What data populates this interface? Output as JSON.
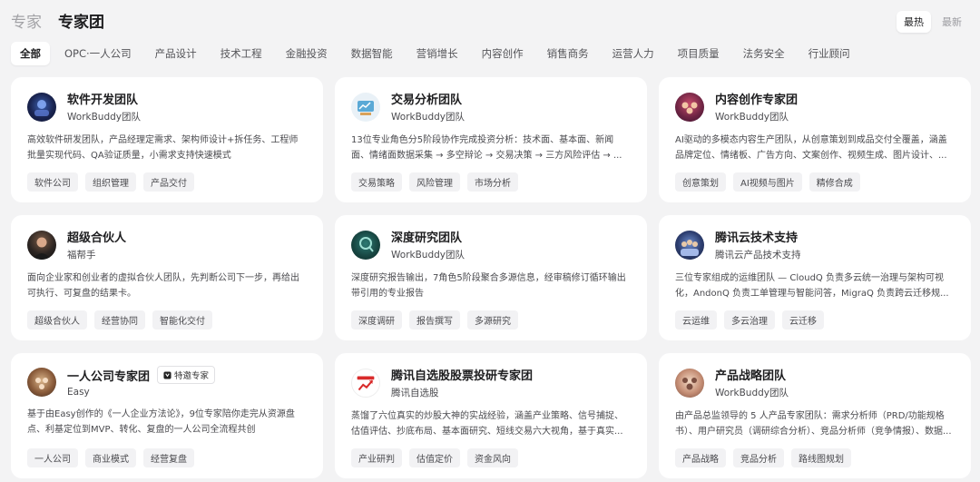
{
  "header": {
    "crumb": "专家",
    "title": "专家团"
  },
  "sort": {
    "hot": "最热",
    "new": "最新"
  },
  "tabs": [
    "全部",
    "OPC·一人公司",
    "产品设计",
    "技术工程",
    "金融投资",
    "数据智能",
    "营销增长",
    "内容创作",
    "销售商务",
    "运营人力",
    "项目质量",
    "法务安全",
    "行业顾问"
  ],
  "cards": [
    {
      "name": "软件开发团队",
      "org": "WorkBuddy团队",
      "desc": "高效软件研发团队，产品经理定需求、架构师设计+拆任务、工程师批量实现代码、QA验证质量，小需求支持快速模式",
      "tags": [
        "软件公司",
        "组织管理",
        "产品交付"
      ]
    },
    {
      "name": "交易分析团队",
      "org": "WorkBuddy团队",
      "desc": "13位专业角色分5阶段协作完成投资分析：技术面、基本面、新闻面、情绪面数据采集 → 多空辩论 → 交易决策 → 三方风险评估 → ...",
      "tags": [
        "交易策略",
        "风险管理",
        "市场分析"
      ]
    },
    {
      "name": "内容创作专家团",
      "org": "WorkBuddy团队",
      "desc": "AI驱动的多模态内容生产团队，从创意策划到成品交付全覆盖，涵盖品牌定位、情绪板、广告方向、文案创作、视频生成、图片设计、...",
      "tags": [
        "创意策划",
        "AI视频与图片",
        "精修合成"
      ]
    },
    {
      "name": "超级合伙人",
      "org": "福帮手",
      "desc": "面向企业家和创业者的虚拟合伙人团队，先判断公司下一步，再给出可执行、可复盘的结果卡。",
      "tags": [
        "超级合伙人",
        "经营协同",
        "智能化交付"
      ]
    },
    {
      "name": "深度研究团队",
      "org": "WorkBuddy团队",
      "desc": "深度研究报告输出，7角色5阶段聚合多源信息，经审稿修订循环输出带引用的专业报告",
      "tags": [
        "深度调研",
        "报告撰写",
        "多源研究"
      ]
    },
    {
      "name": "腾讯云技术支持",
      "org": "腾讯云产品技术支持",
      "desc": "三位专家组成的运维团队 — CloudQ 负责多云统一治理与架构可视化，AndonQ 负责工单管理与智能问答，MigraQ 负责跨云迁移规...",
      "tags": [
        "云运维",
        "多云治理",
        "云迁移"
      ]
    },
    {
      "name": "一人公司专家团",
      "badge": "特邀专家",
      "org": "Easy",
      "desc": "基于由Easy创作的《一人企业方法论》，9位专家陪你走完从资源盘点、利基定位到MVP、转化、复盘的一人公司全流程共创",
      "tags": [
        "一人公司",
        "商业模式",
        "经营复盘"
      ]
    },
    {
      "name": "腾讯自选股股票投研专家团",
      "org": "腾讯自选股",
      "desc": "蒸馏了六位真实的炒股大神的实战经验，涵盖产业策略、信号捕捉、估值评估、抄底布局、基本面研究、短线交易六大视角，基于真实...",
      "tags": [
        "产业研判",
        "估值定价",
        "资金风向"
      ]
    },
    {
      "name": "产品战略团队",
      "org": "WorkBuddy团队",
      "desc": "由产品总监领导的 5 人产品专家团队：需求分析师（PRD/功能规格书）、用户研究员（调研综合分析）、竞品分析师（竞争情报）、数据...",
      "tags": [
        "产品战略",
        "竞品分析",
        "路线图规划"
      ]
    }
  ]
}
